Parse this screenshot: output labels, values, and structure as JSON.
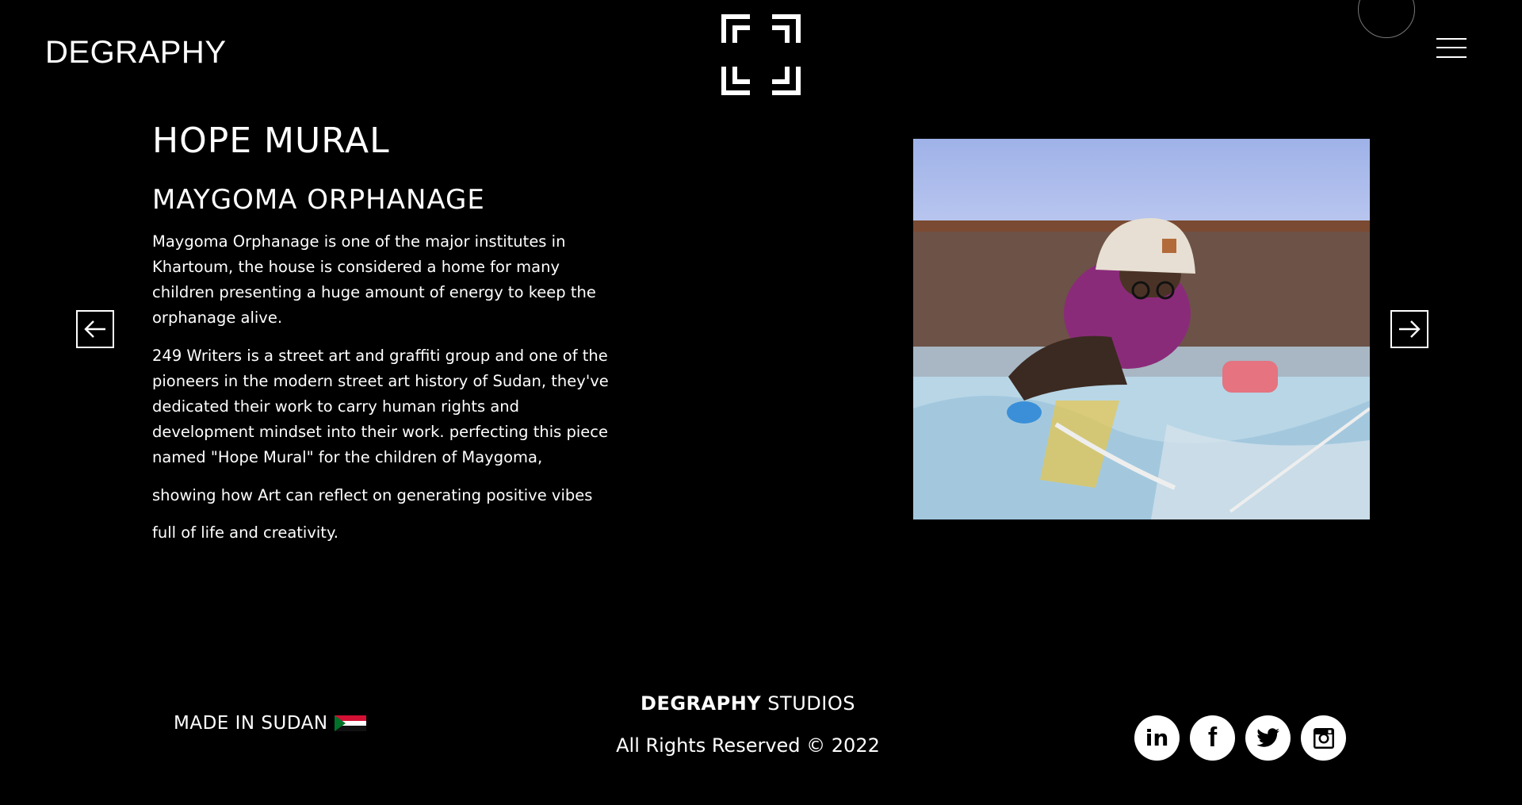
{
  "header": {
    "brand": "DEGRAPHY",
    "logo_icon": "bracket-squares-logo",
    "menu_icon": "hamburger-menu-icon"
  },
  "project": {
    "title": "HOPE MURAL",
    "subtitle": "MAYGOMA ORPHANAGE",
    "paragraphs": [
      "Maygoma Orphanage is one of the major institutes in Khartoum, the house is considered a home for many children presenting a huge amount of energy to keep the orphanage alive.",
      "249 Writers is a street art and graffiti group and one of the pioneers in the modern street art history of Sudan, they've dedicated their work to carry human rights and development mindset into their work. perfecting this piece named \"Hope Mural\" for  the children of Maygoma,"
    ],
    "lines": [
      "showing how Art can reflect on generating positive vibes",
      "full of life and creativity."
    ]
  },
  "carousel": {
    "prev_icon": "arrow-left-icon",
    "next_icon": "arrow-right-icon"
  },
  "footer": {
    "made_in": "MADE IN SUDAN",
    "studio_bold": "DEGRAPHY",
    "studio_rest": "STUDIOS",
    "rights": "All Rights Reserved © 2022",
    "socials": [
      {
        "icon": "linkedin-icon",
        "glyph": "in"
      },
      {
        "icon": "facebook-icon",
        "glyph": "f"
      },
      {
        "icon": "twitter-icon",
        "glyph": ""
      },
      {
        "icon": "instagram-icon",
        "glyph": ""
      }
    ]
  },
  "colors": {
    "background": "#000000",
    "text": "#ffffff",
    "flag_red": "#d21034",
    "flag_green": "#007229"
  }
}
